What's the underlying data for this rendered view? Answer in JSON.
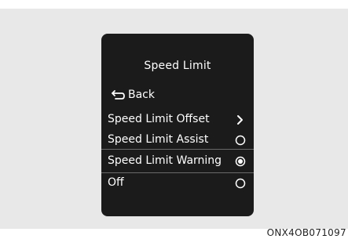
{
  "screen": {
    "title": "Speed Limit",
    "back_label": "Back",
    "items": [
      {
        "label": "Speed Limit Offset",
        "control": "chevron-right"
      },
      {
        "label": "Speed Limit Assist",
        "control": "radio",
        "selected": false
      },
      {
        "label": "Speed Limit Warning",
        "control": "radio",
        "selected": true
      },
      {
        "label": "Off",
        "control": "radio",
        "selected": false
      }
    ]
  },
  "caption": "ONX4OB071097"
}
